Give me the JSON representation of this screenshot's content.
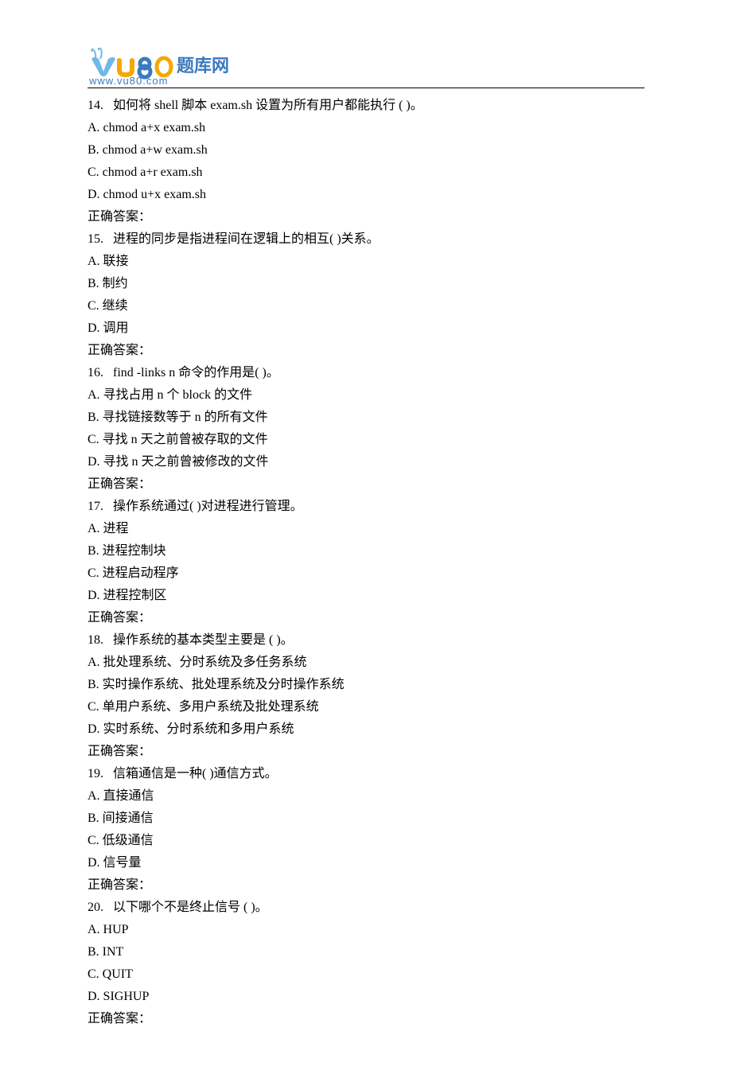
{
  "logo": {
    "url_text": "www.vu80.com",
    "brand_cn": "题库网"
  },
  "questions": [
    {
      "num": "14.",
      "text": "如何将 shell 脚本 exam.sh 设置为所有用户都能执行  ( )。",
      "options": [
        "A. chmod a+x exam.sh",
        "B. chmod a+w exam.sh",
        "C. chmod a+r exam.sh",
        "D. chmod u+x exam.sh"
      ],
      "answer_label": "正确答案："
    },
    {
      "num": "15.",
      "text": "进程的同步是指进程间在逻辑上的相互( )关系。",
      "options": [
        "A.  联接",
        "B.  制约",
        "C.  继续",
        "D.  调用"
      ],
      "answer_label": "正确答案："
    },
    {
      "num": "16.",
      "text": "find -links n  命令的作用是( )。",
      "options": [
        "A.  寻找占用 n 个 block 的文件",
        "B.  寻找链接数等于 n 的所有文件",
        "C.  寻找 n 天之前曾被存取的文件",
        "D.  寻找 n 天之前曾被修改的文件"
      ],
      "answer_label": "正确答案："
    },
    {
      "num": "17.",
      "text": "操作系统通过( )对进程进行管理。",
      "options": [
        "A.  进程",
        "B.  进程控制块",
        "C.  进程启动程序",
        "D.  进程控制区"
      ],
      "answer_label": "正确答案："
    },
    {
      "num": "18.",
      "text": "操作系统的基本类型主要是  ( )。",
      "options": [
        "A.  批处理系统、分时系统及多任务系统",
        "B.  实时操作系统、批处理系统及分时操作系统",
        "C.  单用户系统、多用户系统及批处理系统",
        "D.  实时系统、分时系统和多用户系统"
      ],
      "answer_label": "正确答案："
    },
    {
      "num": "19.",
      "text": "信箱通信是一种( )通信方式。",
      "options": [
        "A.  直接通信",
        "B.  间接通信",
        "C.  低级通信",
        "D.  信号量"
      ],
      "answer_label": "正确答案："
    },
    {
      "num": "20.",
      "text": "以下哪个不是终止信号  ( )。",
      "options": [
        "A. HUP",
        "B. INT",
        "C. QUIT",
        "D. SIGHUP"
      ],
      "answer_label": "正确答案："
    }
  ]
}
